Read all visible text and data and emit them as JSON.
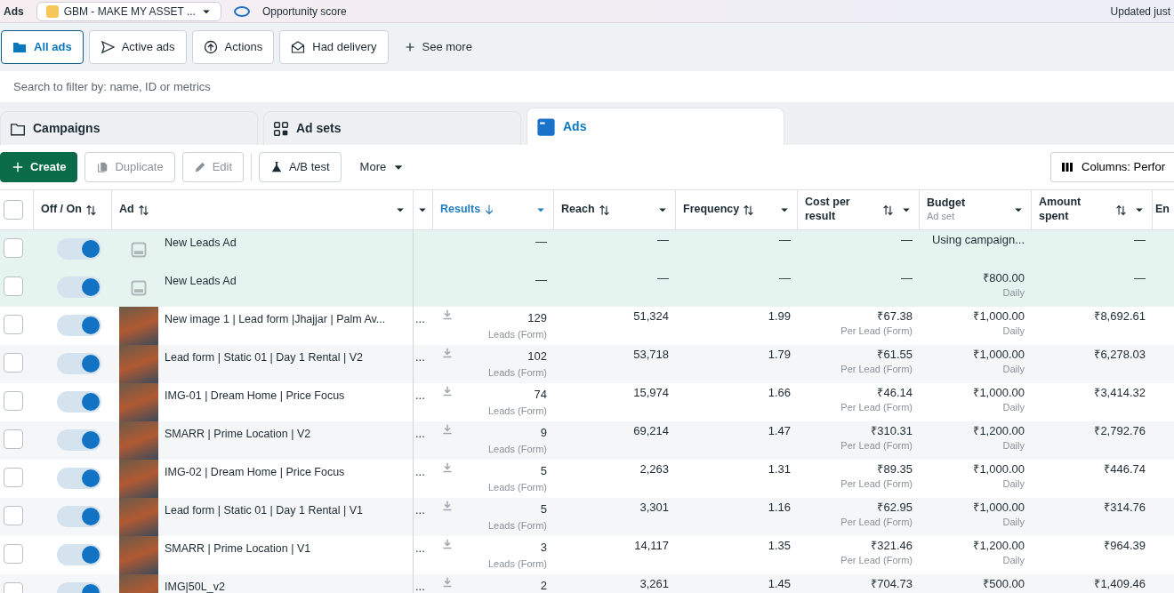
{
  "top_bar": {
    "section": "Ads",
    "account": "GBM - MAKE MY ASSET ...",
    "score_label": "Opportunity score",
    "updated": "Updated just"
  },
  "filters": [
    {
      "label": "All ads",
      "selected": true
    },
    {
      "label": "Active ads",
      "selected": false
    },
    {
      "label": "Actions",
      "selected": false
    },
    {
      "label": "Had delivery",
      "selected": false
    }
  ],
  "see_more": "See more",
  "search": {
    "placeholder": "Search to filter by: name, ID or metrics"
  },
  "level_tabs": [
    {
      "label": "Campaigns",
      "selected": false
    },
    {
      "label": "Ad sets",
      "selected": false
    },
    {
      "label": "Ads",
      "selected": true
    }
  ],
  "toolbar": [
    {
      "kind": "primary",
      "label": "Create",
      "disabled": false
    },
    {
      "kind": "outline",
      "label": "Duplicate",
      "disabled": true
    },
    {
      "kind": "outline",
      "label": "Edit",
      "disabled": true
    },
    {
      "kind": "divider"
    },
    {
      "kind": "outline",
      "label": "A/B test",
      "disabled": false
    },
    {
      "kind": "plain",
      "label": "More",
      "disabled": false
    }
  ],
  "columns_button": "Columns: Perfor",
  "columns": [
    {
      "kind": "check",
      "checked": false
    },
    {
      "kind": "text",
      "label": "Off / On",
      "sortable": true
    },
    {
      "kind": "text",
      "label": "Ad",
      "sortable": true,
      "menu": true
    },
    {
      "kind": "narrow",
      "menu": true
    },
    {
      "kind": "text",
      "label": "Results",
      "sorted": true,
      "menu": true
    },
    {
      "kind": "text",
      "label": "Reach",
      "sortable": true,
      "menu": true
    },
    {
      "kind": "text",
      "label": "Frequency",
      "sortable": true,
      "menu": true
    },
    {
      "kind": "text",
      "label": "Cost per result",
      "sortable": true,
      "menu": true
    },
    {
      "kind": "text",
      "label": "Budget",
      "sub": "Ad set",
      "menu": true
    },
    {
      "kind": "text",
      "label": "Amount spent",
      "sortable": true,
      "menu": true
    },
    {
      "kind": "text",
      "label": "En"
    }
  ],
  "rows": [
    {
      "checked": false,
      "on": true,
      "highlighted": true,
      "kind": "draft",
      "name": "New Leads Ad",
      "results": "—",
      "reach": "—",
      "frequency": "—",
      "cost": "—",
      "budget": "Using campaign...",
      "amount": "—"
    },
    {
      "checked": false,
      "on": true,
      "highlighted": true,
      "kind": "draft",
      "name": "New Leads Ad",
      "results": "—",
      "reach": "—",
      "frequency": "—",
      "cost": "—",
      "budget": "₹800.00",
      "budget_sub": "Daily",
      "amount": "—"
    },
    {
      "checked": false,
      "on": true,
      "highlighted": false,
      "kind": "image",
      "name": "New image 1 | Lead form |Jhajjar | Palm Av...",
      "more": "...",
      "download": true,
      "results": "129",
      "results_sub": "Leads (Form)",
      "reach": "51,324",
      "frequency": "1.99",
      "cost": "₹67.38",
      "cost_sub": "Per Lead (Form)",
      "budget": "₹1,000.00",
      "budget_sub": "Daily",
      "amount": "₹8,692.61"
    },
    {
      "checked": false,
      "on": true,
      "highlighted": false,
      "kind": "image",
      "name": "Lead form | Static 01 | Day 1 Rental | V2",
      "more": "...",
      "download": true,
      "results": "102",
      "results_sub": "Leads (Form)",
      "reach": "53,718",
      "frequency": "1.79",
      "cost": "₹61.55",
      "cost_sub": "Per Lead (Form)",
      "budget": "₹1,000.00",
      "budget_sub": "Daily",
      "amount": "₹6,278.03"
    },
    {
      "checked": false,
      "on": true,
      "highlighted": false,
      "kind": "image",
      "name": "IMG-01 | Dream Home | Price Focus",
      "more": "...",
      "download": true,
      "results": "74",
      "results_sub": "Leads (Form)",
      "reach": "15,974",
      "frequency": "1.66",
      "cost": "₹46.14",
      "cost_sub": "Per Lead (Form)",
      "budget": "₹1,000.00",
      "budget_sub": "Daily",
      "amount": "₹3,414.32"
    },
    {
      "checked": false,
      "on": true,
      "highlighted": false,
      "kind": "image",
      "name": "SMARR | Prime Location | V2",
      "more": "...",
      "download": true,
      "results": "9",
      "results_sub": "Leads (Form)",
      "reach": "69,214",
      "frequency": "1.47",
      "cost": "₹310.31",
      "cost_sub": "Per Lead (Form)",
      "budget": "₹1,200.00",
      "budget_sub": "Daily",
      "amount": "₹2,792.76"
    },
    {
      "checked": false,
      "on": true,
      "highlighted": false,
      "kind": "image",
      "name": "IMG-02 | Dream Home | Price Focus",
      "more": "...",
      "download": true,
      "results": "5",
      "results_sub": "Leads (Form)",
      "reach": "2,263",
      "frequency": "1.31",
      "cost": "₹89.35",
      "cost_sub": "Per Lead (Form)",
      "budget": "₹1,000.00",
      "budget_sub": "Daily",
      "amount": "₹446.74"
    },
    {
      "checked": false,
      "on": true,
      "highlighted": false,
      "kind": "image",
      "name": "Lead form | Static 01 | Day 1 Rental | V1",
      "more": "...",
      "download": true,
      "results": "5",
      "results_sub": "Leads (Form)",
      "reach": "3,301",
      "frequency": "1.16",
      "cost": "₹62.95",
      "cost_sub": "Per Lead (Form)",
      "budget": "₹1,000.00",
      "budget_sub": "Daily",
      "amount": "₹314.76"
    },
    {
      "checked": false,
      "on": true,
      "highlighted": false,
      "kind": "image",
      "name": "SMARR | Prime Location | V1",
      "more": "...",
      "download": true,
      "results": "3",
      "results_sub": "Leads (Form)",
      "reach": "14,117",
      "frequency": "1.35",
      "cost": "₹321.46",
      "cost_sub": "Per Lead (Form)",
      "budget": "₹1,200.00",
      "budget_sub": "Daily",
      "amount": "₹964.39"
    },
    {
      "checked": false,
      "on": true,
      "highlighted": false,
      "kind": "image",
      "name": "IMG|50L_v2",
      "more": "...",
      "download": true,
      "results": "2",
      "reach": "3,261",
      "frequency": "1.45",
      "cost": "₹704.73",
      "budget": "₹500.00",
      "amount": "₹1,409.46"
    }
  ]
}
